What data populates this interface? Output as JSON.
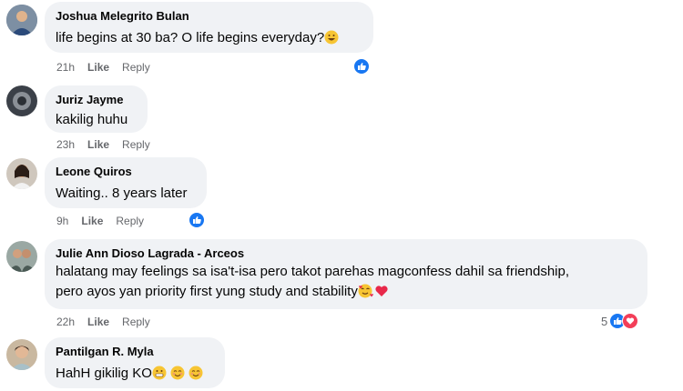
{
  "actions": {
    "like": "Like",
    "reply": "Reply"
  },
  "colors": {
    "bubble": "#f0f2f5",
    "like_blue": "#1877f2",
    "heart_red": "#f33e58",
    "meta_gray": "#65676b"
  },
  "comments": [
    {
      "author": "Joshua Melegrito Bulan",
      "text": "life begins at 30 ba? O life begins everyday?",
      "time": "21h",
      "reaction": "like-icon"
    },
    {
      "author": "Juriz Jayme",
      "text": "kakilig huhu",
      "time": "23h"
    },
    {
      "author": "Leone Quiros",
      "text": "Waiting.. 8 years later",
      "time": "9h",
      "reaction": "like-icon"
    },
    {
      "author": "Julie Ann Dioso Lagrada - Arceos",
      "text_line1": "halatang may feelings sa isa't-isa pero takot parehas magconfess dahil sa friendship,",
      "text_line2": "pero ayos yan priority first yung study and stability",
      "time": "22h",
      "reaction_count": "5",
      "reactions": [
        "like-icon",
        "heart-icon"
      ]
    },
    {
      "author": "Pantilgan R. Myla",
      "text": "HahH gikilig KO",
      "time": ""
    }
  ]
}
